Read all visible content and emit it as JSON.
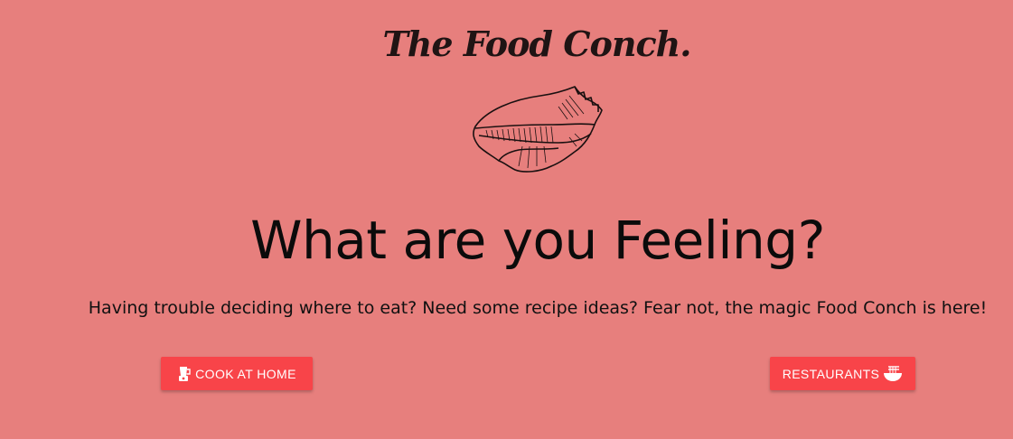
{
  "header": {
    "brand": "The Food Conch."
  },
  "logo": {
    "icon": "conch-shell-icon"
  },
  "hero": {
    "headline": "What are you Feeling?",
    "subtitle": "Having trouble deciding where to eat? Need some recipe ideas? Fear not, the magic Food Conch is here!"
  },
  "actions": {
    "cook_label": "COOK AT HOME",
    "cook_icon": "blender-icon",
    "restaurants_label": "RESTAURANTS",
    "restaurants_icon": "noodle-bowl-icon"
  },
  "colors": {
    "background": "#e77f7d",
    "button": "#f84449",
    "text": "#111111"
  }
}
